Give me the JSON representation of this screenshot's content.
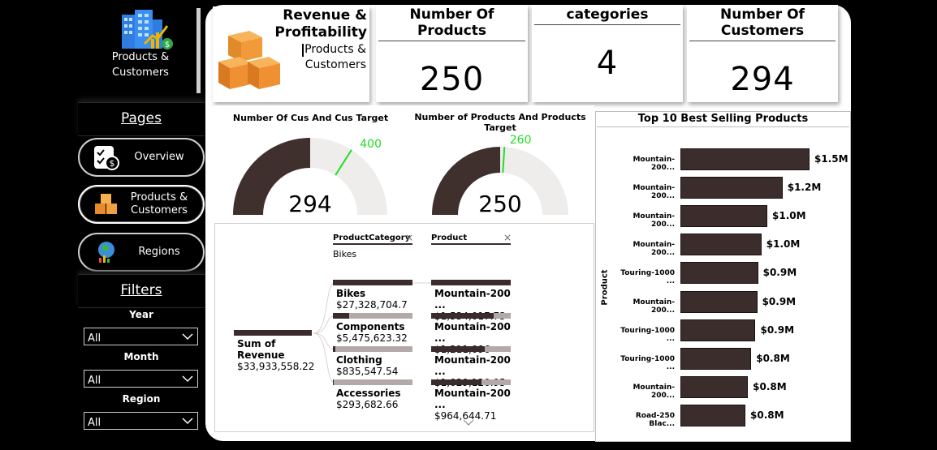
{
  "sidebar": {
    "title": "Products &\nCustomers",
    "pages_heading": "Pages",
    "nav": [
      {
        "label": "Overview",
        "icon": "overview-icon"
      },
      {
        "label": "Products &\nCustomers",
        "icon": "boxes-icon"
      },
      {
        "label": "Regions",
        "icon": "globe-icon"
      }
    ],
    "filters_heading": "Filters",
    "filters": [
      {
        "label": "Year",
        "value": "All"
      },
      {
        "label": "Month",
        "value": "All"
      },
      {
        "label": "Region",
        "value": "All"
      }
    ]
  },
  "header": {
    "title": "Revenue &\nProfitability",
    "subtitle": "Products &\nCustomers"
  },
  "kpis": [
    {
      "title": "Number Of Products",
      "value": "250"
    },
    {
      "title": "categories",
      "value": "4"
    },
    {
      "title": "Number Of Customers",
      "value": "294"
    }
  ],
  "gauges": [
    {
      "title": "Number Of Cus And Cus Target",
      "value": 294,
      "target": 400,
      "max": 588,
      "value_label": "294",
      "target_label": "400"
    },
    {
      "title": "Number of Products And Products Target",
      "value": 250,
      "target": 260,
      "max": 500,
      "value_label": "250",
      "target_label": "260"
    }
  ],
  "decomp": {
    "col1_header": "ProductCategory",
    "col1_filter": "Bikes",
    "col2_header": "Product",
    "root": {
      "label": "Sum of Revenue",
      "value": "$33,933,558.22"
    },
    "categories": [
      {
        "label": "Bikes",
        "value": "$27,328,704.7",
        "fill": 1.0
      },
      {
        "label": "Components",
        "value": "$5,475,623.32",
        "fill": 0.2
      },
      {
        "label": "Clothing",
        "value": "$835,547.54",
        "fill": 0.03
      },
      {
        "label": "Accessories",
        "value": "$293,682.66",
        "fill": 0.011
      }
    ],
    "products": [
      {
        "label": "Mountain-200 ...",
        "value": "$1,534,017.73",
        "fill": 1.0
      },
      {
        "label": "Mountain-200 ...",
        "value": "$1,211,096",
        "fill": 0.79
      },
      {
        "label": "Mountain-200 ...",
        "value": "$1,029,120.95",
        "fill": 0.67
      },
      {
        "label": "Mountain-200 ...",
        "value": "$964,644.71",
        "fill": 0.63
      }
    ]
  },
  "chart_data": {
    "type": "bar",
    "title": "Top 10 Best Selling Products",
    "ylabel": "Product",
    "categories": [
      "Mountain-200...",
      "Mountain-200...",
      "Mountain-200...",
      "Mountain-200...",
      "Touring-1000 ...",
      "Mountain-200...",
      "Touring-1000 ...",
      "Touring-1000 ...",
      "Mountain-200...",
      "Road-250 Blac..."
    ],
    "values": [
      1.53,
      1.21,
      1.03,
      0.96,
      0.92,
      0.91,
      0.89,
      0.84,
      0.8,
      0.77
    ],
    "labels": [
      "$1.5M",
      "$1.2M",
      "$1.0M",
      "$1.0M",
      "$0.9M",
      "$0.9M",
      "$0.9M",
      "$0.8M",
      "$0.8M",
      "$0.8M"
    ],
    "orientation": "horizontal",
    "color": "#3b2d2b"
  },
  "colors": {
    "gauge_fill": "#3f302e",
    "gauge_track": "#efedec",
    "target": "#22dd22"
  }
}
